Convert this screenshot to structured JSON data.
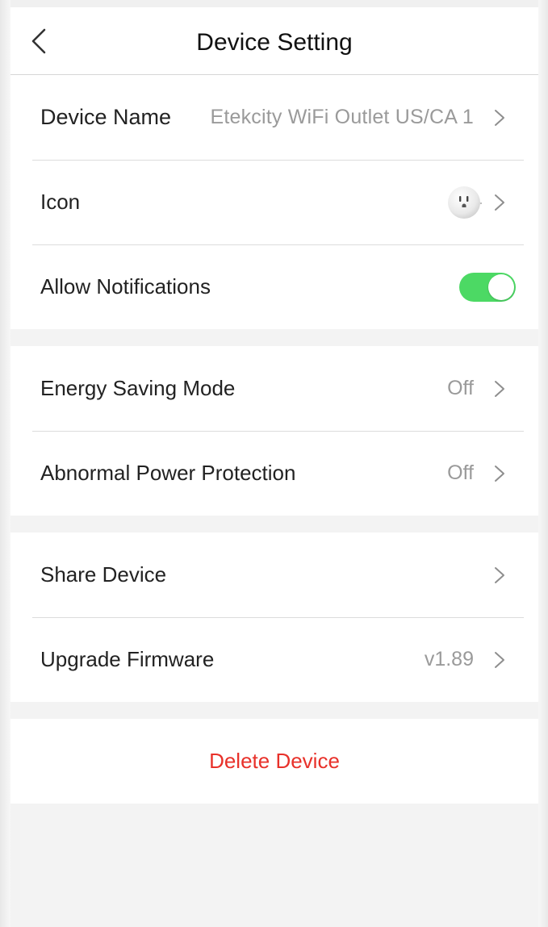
{
  "header": {
    "title": "Device Setting",
    "back_icon": "chevron-left-icon"
  },
  "section_general": {
    "device_name_label": "Device Name",
    "device_name_value": "Etekcity  WiFi Outlet US/CA 1",
    "icon_label": "Icon",
    "icon_value_icon": "outlet-icon",
    "notifications_label": "Allow Notifications",
    "notifications_enabled": true
  },
  "section_power": {
    "energy_saving_label": "Energy Saving Mode",
    "energy_saving_value": "Off",
    "abnormal_protection_label": "Abnormal Power Protection",
    "abnormal_protection_value": "Off"
  },
  "section_device": {
    "share_label": "Share Device",
    "firmware_label": "Upgrade Firmware",
    "firmware_value": "v1.89"
  },
  "delete": {
    "label": "Delete Device"
  },
  "colors": {
    "toggle_on": "#4cd964",
    "delete_text": "#e8312a",
    "secondary_text": "#9a9a9a",
    "background": "#f3f3f3"
  }
}
